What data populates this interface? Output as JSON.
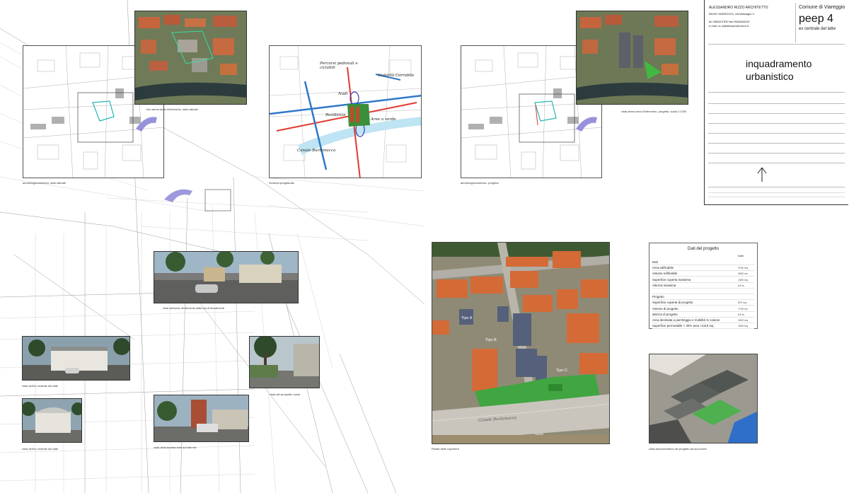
{
  "title_block": {
    "studio_name": "ALESSANDRO RIZZO ARCHITETTO",
    "studio_address": "55049 VIAREGGIO, via Massagni 3",
    "studio_phone": "tel 0584407530    fax 0584408319",
    "studio_email": "e-mail: a.r.a@alessandrorizzo.it",
    "client": "Comune di Viareggio",
    "project_code": "peep 4",
    "project_site": "ex centrale del latte",
    "drawing_title_1": "inquadramento",
    "drawing_title_2": "urbanistico"
  },
  "captions": {
    "aerophoto_current": "aerofotogrammetrico, stato attuale",
    "aerial_photo_current": "foto aerea area d'intervento, stato attuale",
    "design_scheme": "Schema progettuale",
    "aerophoto_project": "aerofotogrammetrico, progetto",
    "aerial_photo_project": "vista aerea area d'intervento, progetto, scala 1:1000",
    "view_monteverdi": "vista dell'area d'intervento dalla via di Monteverdi",
    "view_centrale_1": "vista dell'ex centrale del latte",
    "view_centrale_2": "vista dell'ex centrale del latte",
    "view_southwest": "vista del prospetto ovest",
    "view_tower": "vista della torretta enel sul lato est",
    "roof_plan": "Pianta delle coperture",
    "axonometric": "vista assonometrica del progetto da sud-ovest"
  },
  "scheme_labels": {
    "pedestrian": "Percorsi pedonali e ciclabili",
    "traffic": "Viabilità Carrabile",
    "nodes": "Nodi",
    "residences": "Residenze",
    "green": "Aree a verde",
    "canal": "Canale Burlamacca"
  },
  "roof_plan_labels": {
    "type_a": "Tipo A",
    "type_b": "Tipo B",
    "type_c": "Tipo C",
    "canal": "Canale Burlamacca"
  },
  "project_data": {
    "heading": "Dati del progetto",
    "col_header": "Note",
    "rows": [
      {
        "label": "Dati",
        "value": ""
      },
      {
        "label": "Area edificabile",
        "value": "3700 mq"
      },
      {
        "label": "Volume edificabile",
        "value": "3000 mc"
      },
      {
        "label": "Superficie coperta massima",
        "value": "1390 mq"
      },
      {
        "label": "Altezza massima",
        "value": "8,5 m"
      },
      {
        "label": "",
        "value": ""
      },
      {
        "label": "Progetto",
        "value": ""
      },
      {
        "label": "Superficie coperta di progetto",
        "value": "870 mq"
      },
      {
        "label": "Volume di progetto",
        "value": "7730 mc"
      },
      {
        "label": "altezza di progetto",
        "value": "8,5 m"
      },
      {
        "label": "Area destinata a parcheggio e mobilità  % volume",
        "value": "1500 mq"
      },
      {
        "label": "Superficie permeabile > 30% area >1110 mq",
        "value": "1535 mq"
      }
    ]
  },
  "colors": {
    "canal": "#b9dff0",
    "roof": "#d96e3c",
    "grass": "#4db04d",
    "pedestrian": "#e03a2f",
    "traffic": "#2f77c9",
    "arrow": "#8d86d6"
  }
}
